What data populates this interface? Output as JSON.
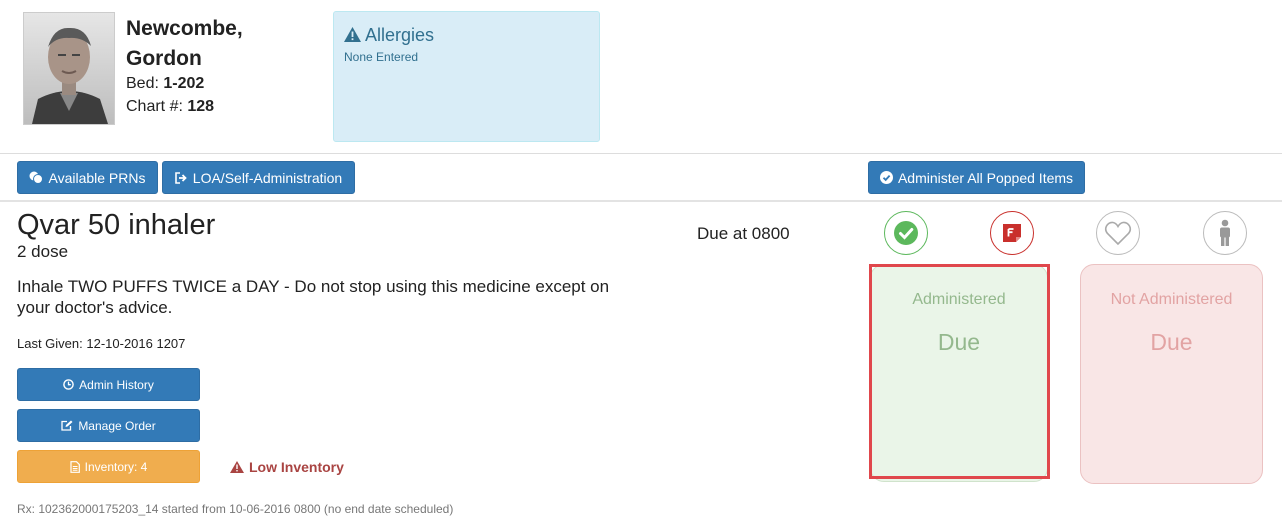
{
  "patient": {
    "photo_icon": "patient-photo",
    "name_line1": "Newcombe,",
    "name_line2": "Gordon",
    "bed_label": "Bed: ",
    "bed_value": "1-202",
    "chart_label": "Chart #: ",
    "chart_value": "128"
  },
  "allergies": {
    "icon": "warning-icon",
    "title": "Allergies",
    "value": "None Entered"
  },
  "toolbar": {
    "prn_label": "Available PRNs",
    "loa_label": "LOA/Self-Administration",
    "administer_all_label": "Administer All Popped Items"
  },
  "medication": {
    "name": "Qvar 50 inhaler",
    "dose": "2 dose",
    "instructions": "Inhale TWO PUFFS TWICE a DAY - Do not stop using this medicine except on your doctor's advice.",
    "last_given": "Last Given: 12-10-2016 1207",
    "due": "Due at 0800",
    "admin_history_label": "Admin History",
    "manage_order_label": "Manage Order",
    "inventory_label": "Inventory: 4",
    "low_inventory": "Low Inventory",
    "rx": "Rx: 102362000175203_14 started from 10-06-2016 0800 (no end date scheduled)"
  },
  "status_icons": [
    "check-circle-icon",
    "flag-icon",
    "heart-icon",
    "person-icon"
  ],
  "cards": {
    "administered": {
      "label": "Administered",
      "status": "Due"
    },
    "not_administered": {
      "label": "Not Administered",
      "status": "Due"
    }
  },
  "colors": {
    "primary": "#337ab7",
    "warning_button": "#f0ad4e",
    "danger": "#a94442",
    "info_bg": "#d9edf7",
    "success": "#5cb85c",
    "selection_border": "#e0474c"
  }
}
